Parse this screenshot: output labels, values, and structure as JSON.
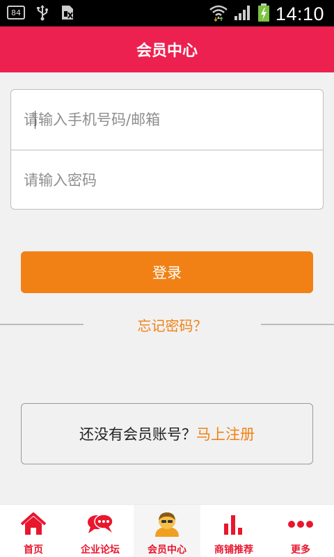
{
  "status_bar": {
    "badge": "84",
    "time": "14:10",
    "icons": [
      "usb-icon",
      "sim-icon",
      "wifi-icon",
      "signal-icon",
      "battery-charging-icon"
    ]
  },
  "header": {
    "title": "会员中心"
  },
  "login_form": {
    "phone_placeholder": "请输入手机号码/邮箱",
    "password_placeholder": "请输入密码",
    "phone_value": "",
    "password_value": ""
  },
  "login_button": {
    "label": "登录"
  },
  "forgot": {
    "label": "忘记密码？"
  },
  "register": {
    "prompt": "还没有会员账号？",
    "link": "马上注册"
  },
  "tab_bar": {
    "items": [
      {
        "label": "首页",
        "icon": "home-icon",
        "active": false
      },
      {
        "label": "企业论坛",
        "icon": "chat-bubbles-icon",
        "active": false
      },
      {
        "label": "会员中心",
        "icon": "user-icon",
        "active": true
      },
      {
        "label": "商铺推荐",
        "icon": "bar-chart-icon",
        "active": false
      },
      {
        "label": "更多",
        "icon": "more-dots-icon",
        "active": false
      }
    ]
  },
  "colors": {
    "brand": "#ec2150",
    "accent": "#f18115",
    "tab_label": "#e8172e"
  }
}
